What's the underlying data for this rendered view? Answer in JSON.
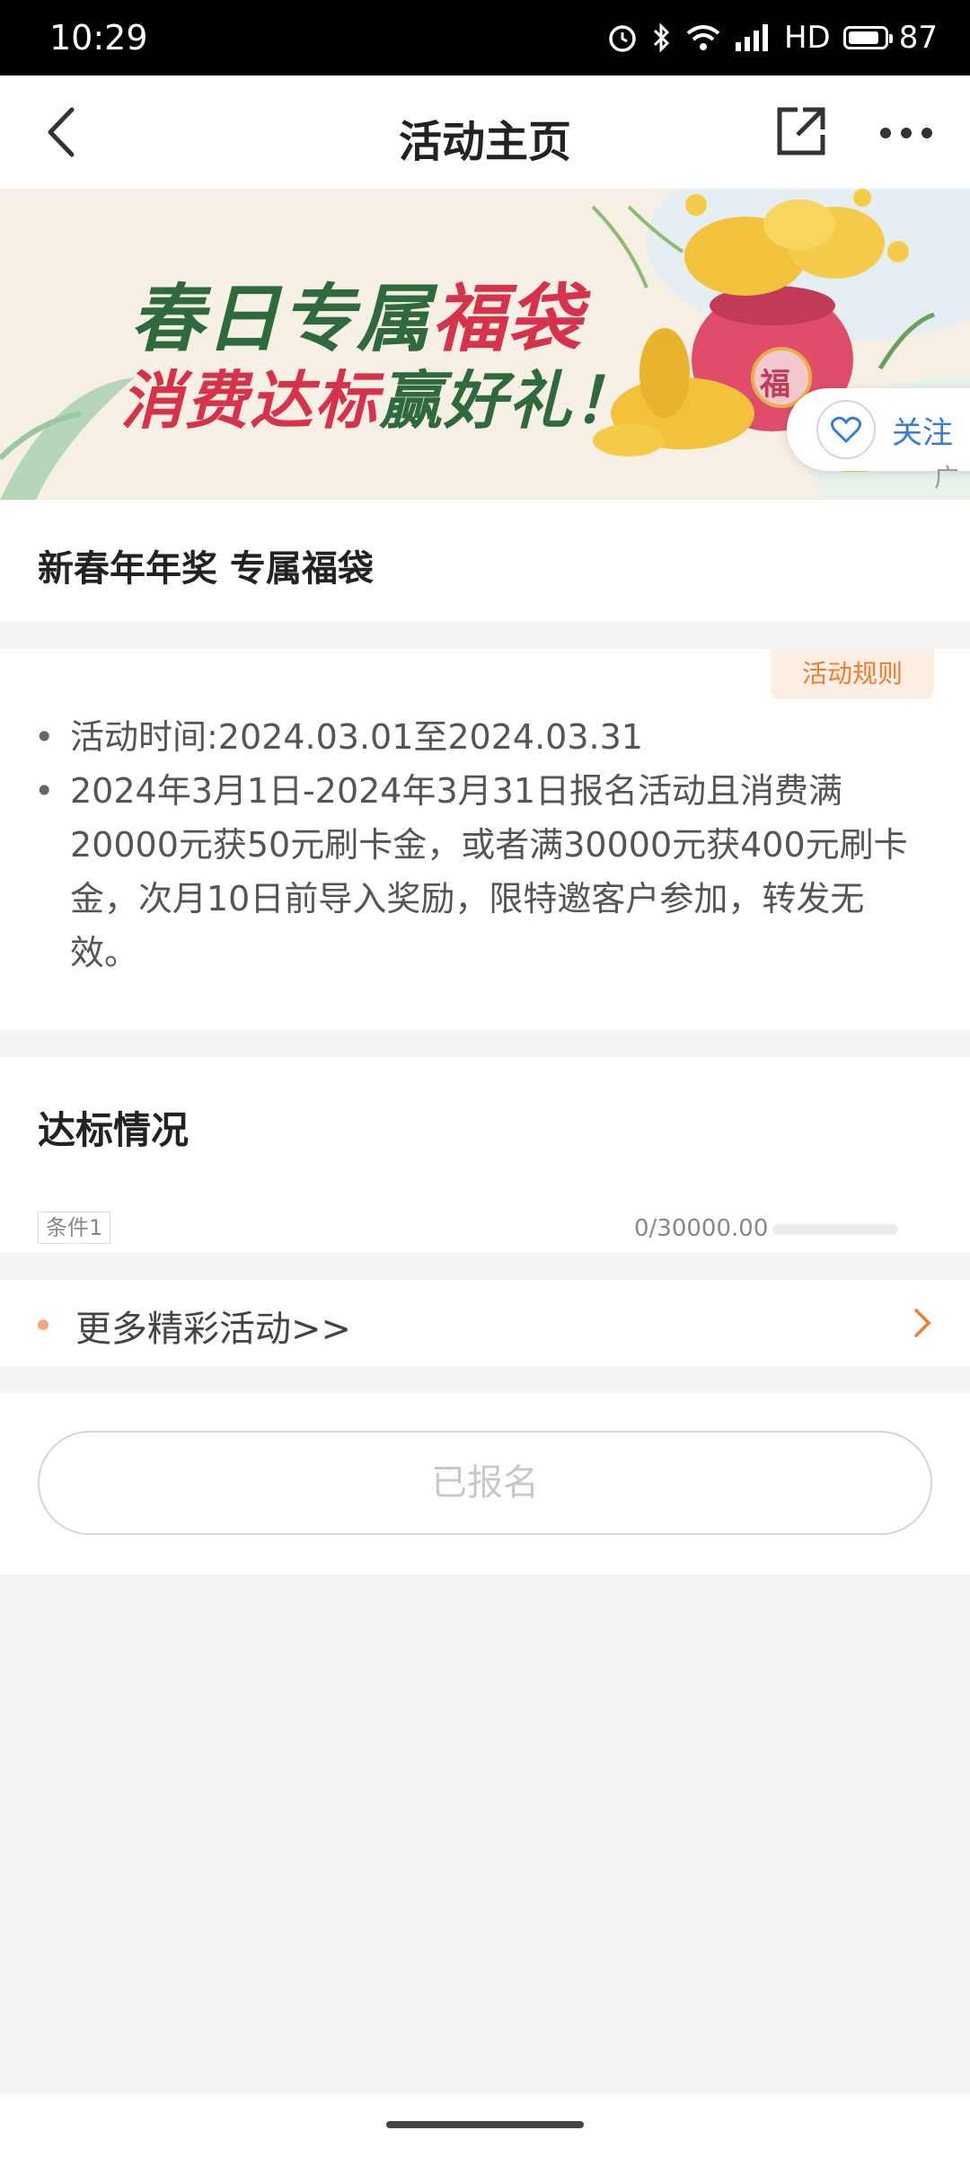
{
  "status_bar": {
    "time": "10:29",
    "network_label": "HD",
    "battery_level": "87",
    "battery_fraction": 0.87
  },
  "nav": {
    "title": "活动主页"
  },
  "banner": {
    "line1_a": "春日专属",
    "line1_b": "福袋",
    "line2_a": "消费达标",
    "line2_b": "赢好礼！",
    "bag_char": "福",
    "follow_label": "关注",
    "ad_mark": "广告"
  },
  "activity": {
    "title": "新春年年奖 专属福袋"
  },
  "rules": {
    "tag": "活动规则",
    "items": [
      "活动时间:2024.03.01至2024.03.31",
      "2024年3月1日-2024年3月31日报名活动且消费满20000元获50元刷卡金，或者满30000元获400元刷卡金，次月10日前导入奖励，限特邀客户参加，转发无效。"
    ]
  },
  "progress": {
    "heading": "达标情况",
    "condition_label": "条件1",
    "value_text": "0/30000.00",
    "fraction": 0
  },
  "more": {
    "label": "更多精彩活动>>"
  },
  "signup": {
    "label": "已报名"
  },
  "colors": {
    "accent": "#f07c33",
    "banner_green": "#2e6a3c",
    "banner_red": "#d6334a",
    "follow_blue": "#3a7bd5"
  }
}
